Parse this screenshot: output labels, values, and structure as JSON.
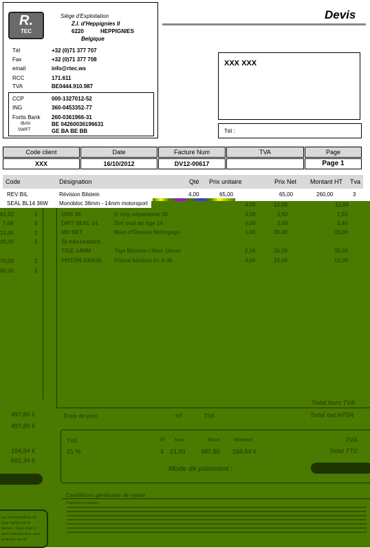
{
  "company": {
    "logo_text": "R.",
    "logo_sub": "TEC",
    "site_label": "Siège d'Exploitation",
    "address1": "Z.I. d'Heppignies II",
    "postal": "6220",
    "city": "HEPPIGNIES",
    "country": "Belgique",
    "contacts": [
      {
        "label": "Tél",
        "value": "+32 (0)71 377 707"
      },
      {
        "label": "Fax",
        "value": "+32 (0)71 377 708"
      },
      {
        "label": "email",
        "value": "info@rtec.ws"
      },
      {
        "label": "RCC",
        "value": "171.611"
      },
      {
        "label": "TVA",
        "value": "BE0444.910.987"
      }
    ],
    "bank": {
      "ccp_label": "CCP",
      "ccp": "000-1327012-52",
      "ing_label": "ING",
      "ing": "360-0453352-77",
      "fortis_label": "Fortis Bank",
      "fortis": "260-0361966-31",
      "iban_label": "IBAN",
      "iban": "BE 04260036196631",
      "swift_label": "SWIFT",
      "swift": "GE BA BE BB"
    }
  },
  "doc_title": "Devis",
  "client": {
    "name": "XXX XXX",
    "tel_label": "Tél :"
  },
  "header_fields": {
    "labels": [
      "Code client",
      "Date",
      "Facture Num",
      "TVA",
      "Page"
    ],
    "values": [
      "XXX",
      "16/10/2012",
      "DV12-00617",
      "",
      "Page 1"
    ]
  },
  "columns": [
    "Code",
    "Désignation",
    "Qté",
    "Prix unitaire",
    "Prix Net",
    "Montant HT",
    "Tva"
  ],
  "rows": [
    {
      "code": "REV BIL",
      "designation": "Révision Bilstein",
      "qty": "4,00",
      "pu": "65,00",
      "net": "65,00",
      "total": "260,00",
      "tva": "3"
    },
    {
      "code": "SEAL BL14 36W",
      "designation": "Monobloc 36mm - 14mm motorsport",
      "qty": "",
      "pu": "",
      "net": "",
      "total": "",
      "tva": ""
    },
    {
      "code": "",
      "designation": "",
      "qty": "4,00",
      "pu": "",
      "net": "12,88",
      "total": "12,88",
      "tva": ""
    },
    {
      "code": "ORS 36",
      "designation": "O ring séparateur 36",
      "qty": "4,00",
      "pu": "",
      "net": "1,92",
      "total": "1,92",
      "tva": ""
    },
    {
      "code": "DIRT SEAL 14",
      "designation": "Dirt seal de tige 14",
      "qty": "4,00",
      "pu": "",
      "net": "3,40",
      "total": "3,40",
      "tva": ""
    },
    {
      "code": "MO NET",
      "designation": "Main d'Oeuvre Nettoyage",
      "qty": "1,00",
      "pu": "",
      "net": "35,00",
      "total": "35,00",
      "tva": ""
    },
    {
      "code": "",
      "designation": "Si nécessaire",
      "qty": "",
      "pu": "",
      "net": "",
      "total": "",
      "tva": ""
    },
    {
      "code": "TIGE 14MM",
      "designation": "Tige Bilstein / Rtec 14mm",
      "qty": "2,00",
      "pu": "",
      "net": "35,00",
      "total": "35,00",
      "tva": ""
    },
    {
      "code": "PISTON GRA36",
      "designation": "Piston bilstein Gr A 36",
      "qty": "4,00",
      "pu": "",
      "net": "15,00",
      "total": "15,00",
      "tva": ""
    }
  ],
  "left_col_values": [
    "61,52",
    "7,68",
    "13,00",
    "35,00",
    "70,00",
    "60,00"
  ],
  "left_col_tva": [
    "3",
    "3",
    "3",
    "3",
    "3",
    "3"
  ],
  "totals": {
    "total_hors_tva_label": "Total hors TVA",
    "total_net_htva_label": "Total net HTVA",
    "total_hors_tva": "497,80 €",
    "total_net_htva": "497,80 €",
    "frais_label": "Frais de port",
    "ht_label": "HT",
    "tva_label": "TVA",
    "tva_table_headers": [
      "TVA",
      "N°",
      "Taux",
      "Base",
      "Montant"
    ],
    "tva_row": [
      "21 %",
      "3",
      "21.00",
      "497.80",
      "104.54 €"
    ],
    "tva_right_label": "TVA",
    "ttc_label": "Total TTC",
    "tva_amount": "104,54 €",
    "ttc_amount": "602,34 €",
    "payment_label": "Mode de paiement :"
  },
  "conditions": {
    "title": "Conditions générales de vente",
    "subtitle": "Paiement comptant.",
    "left_note": "Les marchandises de type réglées de la facture. Toute droit et sans marchandise sans préjudice de de Charleroi."
  }
}
